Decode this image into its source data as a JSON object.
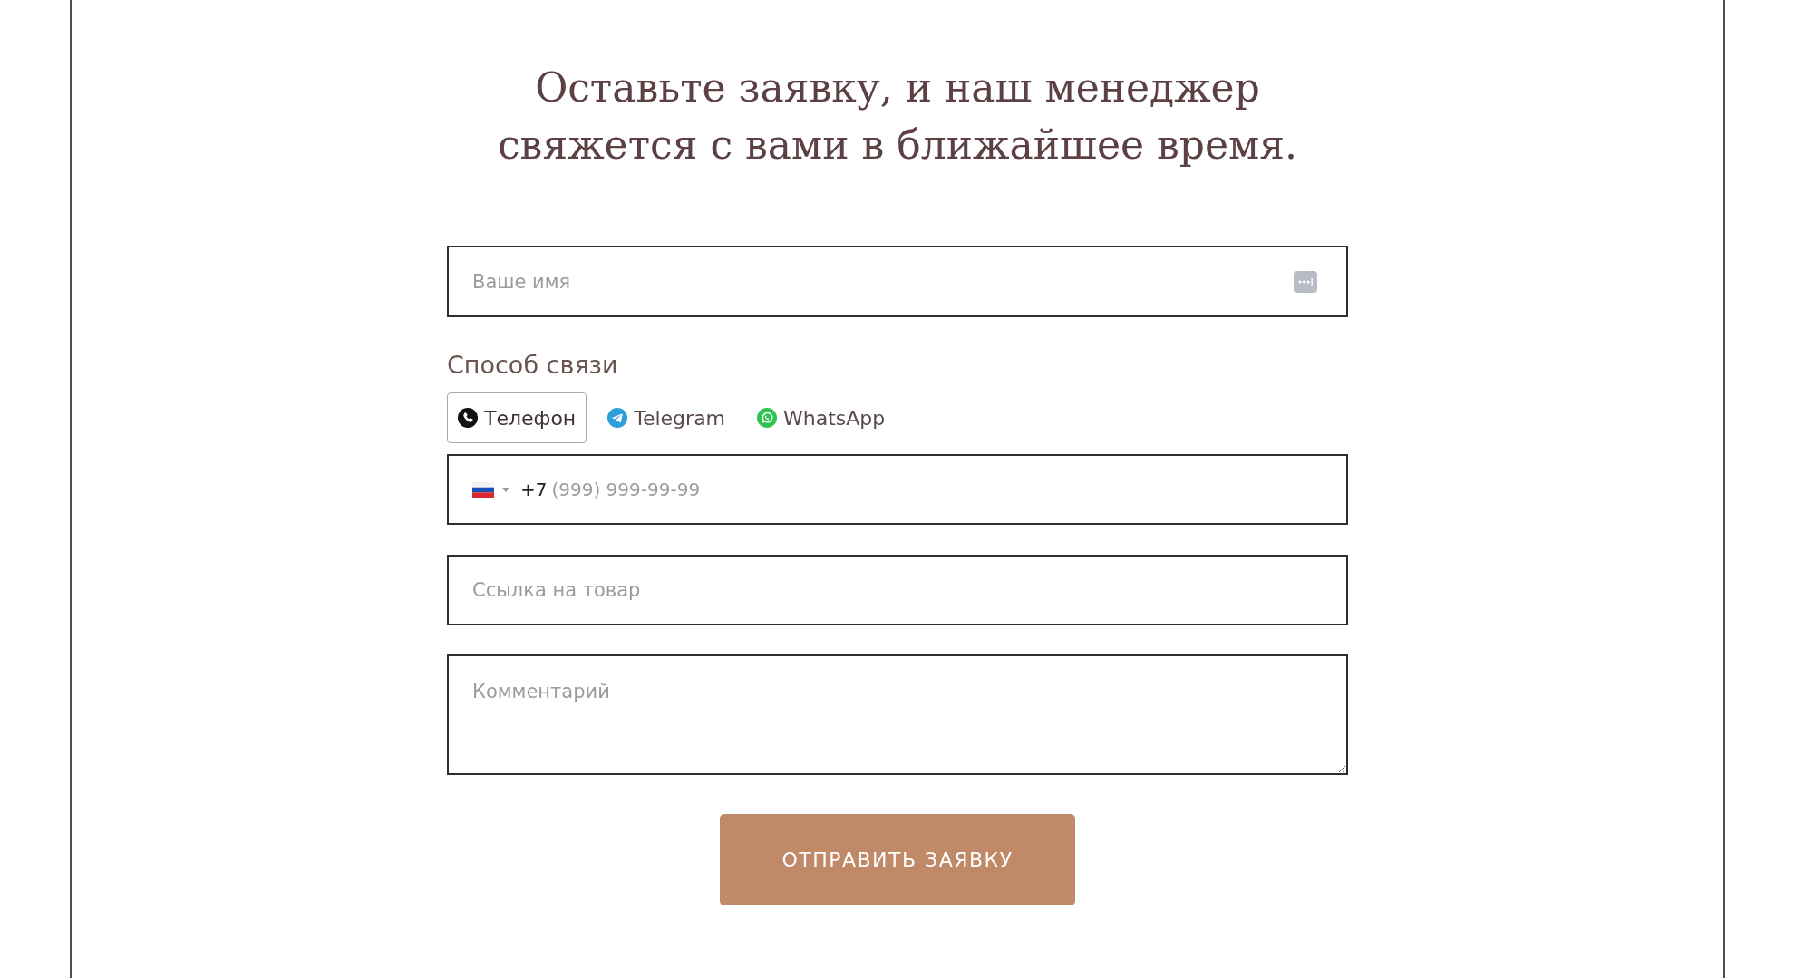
{
  "heading": "Оставьте заявку, и наш менеджер свяжется с вами в ближайшее время.",
  "form": {
    "name_field": {
      "placeholder": "Ваше имя"
    },
    "contact_method": {
      "label": "Способ связи",
      "options": [
        {
          "label": "Телефон",
          "kind": "phone",
          "selected": true
        },
        {
          "label": "Telegram",
          "kind": "telegram",
          "selected": false
        },
        {
          "label": "WhatsApp",
          "kind": "whatsapp",
          "selected": false
        }
      ]
    },
    "phone_field": {
      "country_code": "+7",
      "placeholder": "(999) 999-99-99"
    },
    "link_field": {
      "placeholder": "Ссылка на товар"
    },
    "comment_field": {
      "placeholder": "Комментарий"
    },
    "submit_button": {
      "label": "ОТПРАВИТЬ ЗАЯВКУ"
    }
  }
}
